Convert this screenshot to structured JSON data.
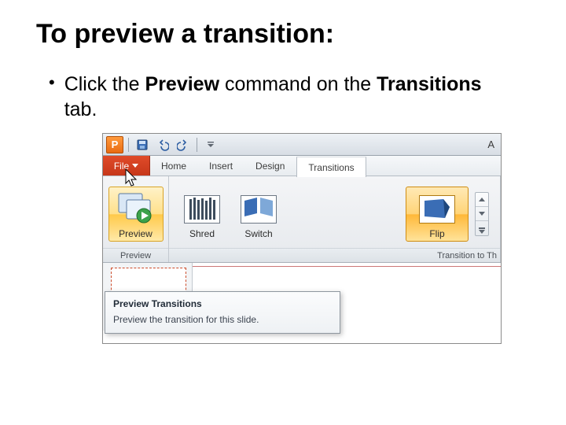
{
  "slide": {
    "title": "To preview a transition:",
    "bullet_pre": "Click the ",
    "bullet_b1": "Preview",
    "bullet_mid": " command on the ",
    "bullet_b2": "Transitions",
    "bullet_post": " tab."
  },
  "app": {
    "badge_letter": "P",
    "title_hint": "A"
  },
  "tabs": {
    "file": "File",
    "home": "Home",
    "insert": "Insert",
    "design": "Design",
    "transitions": "Transitions"
  },
  "ribbon": {
    "preview_label": "Preview",
    "shred_label": "Shred",
    "switch_label": "Switch",
    "flip_label": "Flip",
    "group_preview": "Preview",
    "group_transition": "Transition to Th"
  },
  "tooltip": {
    "title": "Preview Transitions",
    "body": "Preview the transition for this slide."
  }
}
